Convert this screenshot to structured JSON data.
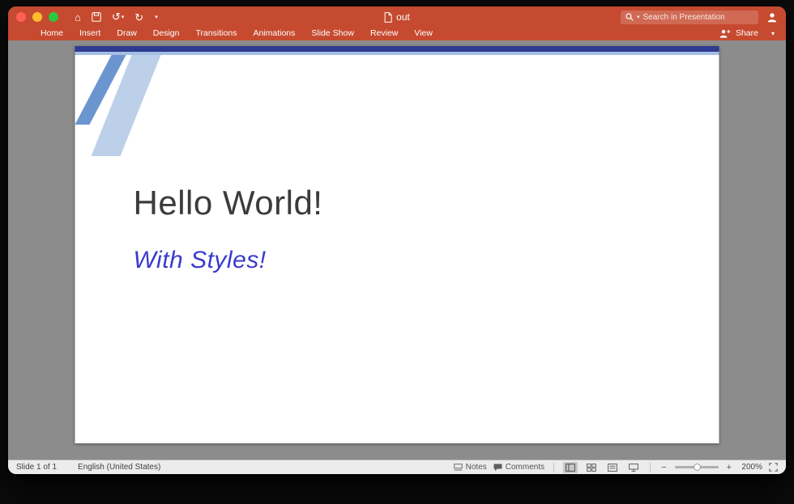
{
  "colors": {
    "titlebar_orange": "#C64A2F",
    "slide_area_gray": "#8C8C8C",
    "theme_dark_blue": "#2E3B90",
    "theme_light_blue": "#A5BFE4",
    "stripe_medium_blue": "#6B95CF",
    "stripe_pale_blue": "#BCD0EA",
    "subtitle_blue": "#3A3ACC",
    "title_gray": "#3B3B3B"
  },
  "titlebar": {
    "document_title": "out",
    "search_placeholder": "Search in Presentation"
  },
  "ribbon": {
    "tabs": [
      "Home",
      "Insert",
      "Draw",
      "Design",
      "Transitions",
      "Animations",
      "Slide Show",
      "Review",
      "View"
    ],
    "share_label": "Share"
  },
  "slide": {
    "title": "Hello World!",
    "subtitle": "With Styles!"
  },
  "statusbar": {
    "slide_indicator": "Slide 1 of 1",
    "language": "English (United States)",
    "notes_label": "Notes",
    "comments_label": "Comments",
    "zoom_level": "200%"
  },
  "icons": {
    "home": "⌂",
    "undo": "↺",
    "redo": "↻",
    "chevron_down": "▾",
    "zoom_out": "−",
    "zoom_in": "+"
  }
}
